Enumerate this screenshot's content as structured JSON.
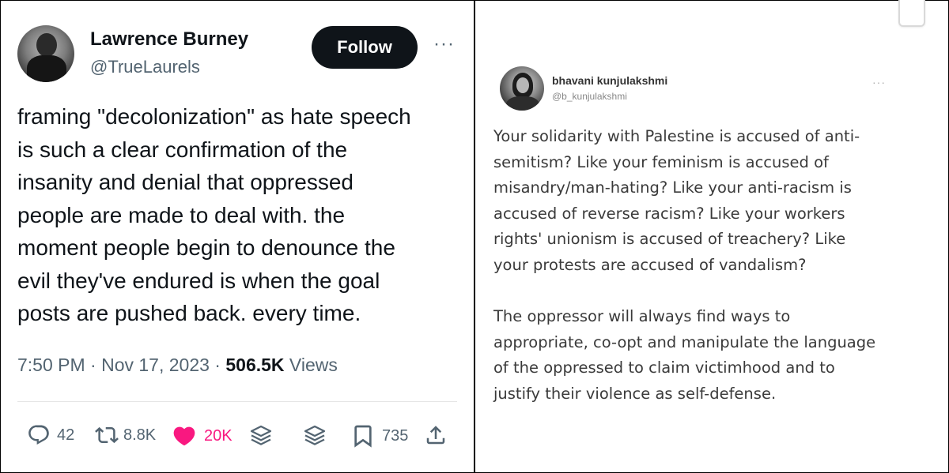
{
  "left_tweet": {
    "author": {
      "name": "Lawrence Burney",
      "handle": "@TrueLaurels"
    },
    "follow_label": "Follow",
    "more_glyph": "···",
    "text": "framing \"decolonization\" as hate speech\nis such a clear confirmation of the\ninsanity and denial that oppressed\npeople are made to deal with. the\nmoment people begin to denounce the\nevil they've endured is when the goal\nposts are pushed back. every time.",
    "timestamp": "7:50 PM · Nov 17, 2023 · ",
    "views_count": "506.5K",
    "views_label": " Views",
    "actions": {
      "replies": "42",
      "retweets": "8.8K",
      "likes": "20K",
      "bookmarks": "735"
    },
    "colors": {
      "like": "#f91880",
      "follow_bg": "#0f1419",
      "muted": "#536471"
    }
  },
  "right_tweet": {
    "author": {
      "name": "bhavani kunjulakshmi",
      "handle": "@b_kunjulakshmi"
    },
    "more_glyph": "···",
    "text": "Your solidarity with Palestine is accused of anti-\nsemitism? Like your feminism is accused of\nmisandry/man-hating? Like your anti-racism is\naccused of reverse racism? Like your workers\nrights' unionism is accused of treachery? Like\nyour protests are accused of vandalism?\n\nThe oppressor will always find ways to\nappropriate, co-opt and manipulate the language\nof the oppressed to claim victimhood and to\njustify their violence as self-defense."
  },
  "icons": [
    "avatar",
    "more-icon",
    "reply-icon",
    "retweet-icon",
    "like-icon",
    "layers-icon",
    "bookmark-icon",
    "share-icon"
  ]
}
